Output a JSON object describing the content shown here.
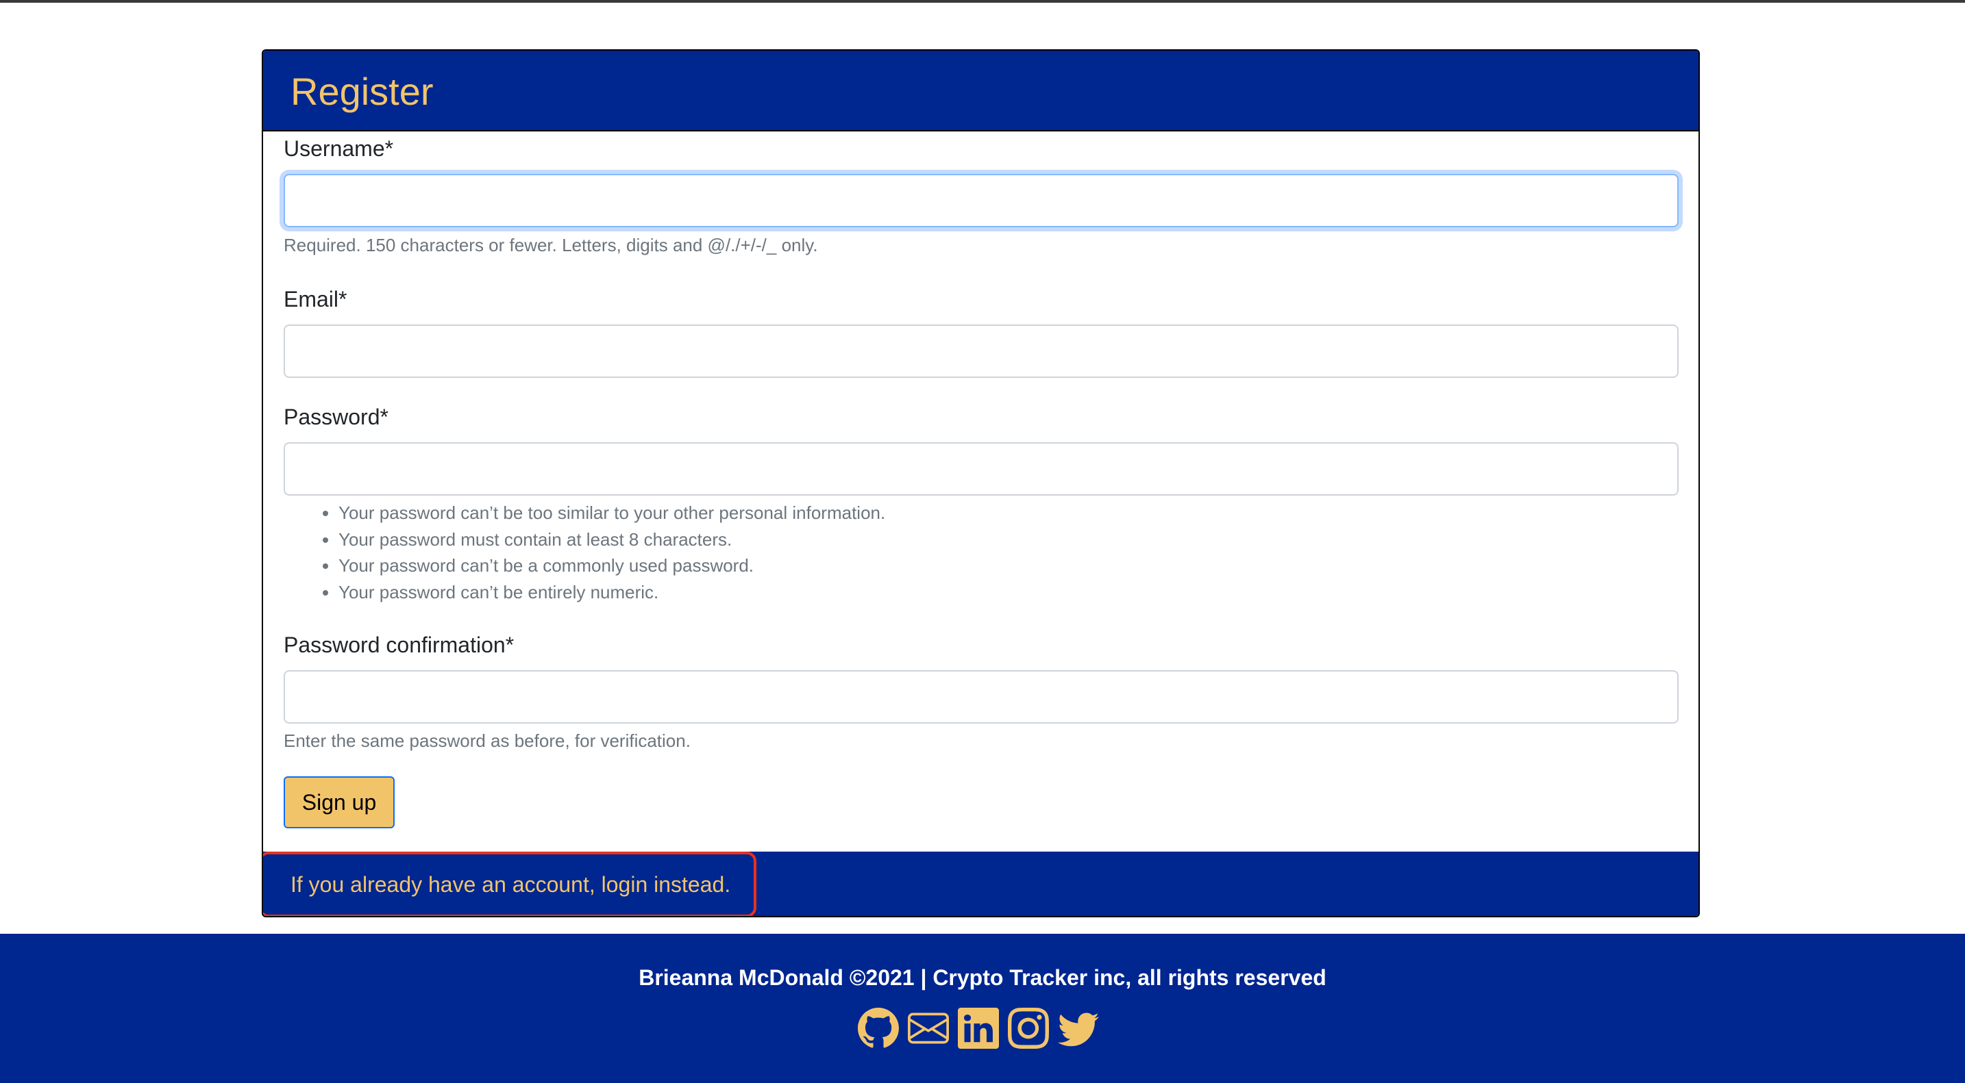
{
  "card": {
    "title": "Register"
  },
  "form": {
    "username": {
      "label": "Username*",
      "value": "",
      "placeholder": "",
      "help": "Required. 150 characters or fewer. Letters, digits and @/./+/-/_ only."
    },
    "email": {
      "label": "Email*",
      "value": "",
      "placeholder": ""
    },
    "password": {
      "label": "Password*",
      "value": "",
      "placeholder": "",
      "help_items": [
        "Your password can’t be too similar to your other personal information.",
        "Your password must contain at least 8 characters.",
        "Your password can’t be a commonly used password.",
        "Your password can’t be entirely numeric."
      ]
    },
    "password_confirmation": {
      "label": "Password confirmation*",
      "value": "",
      "placeholder": "",
      "help": "Enter the same password as before, for verification."
    },
    "submit_label": "Sign up"
  },
  "card_footer": {
    "prefix": "If you already have an account, ",
    "link_label": "login",
    "suffix": " instead."
  },
  "site_footer": {
    "copyright": "Brieanna McDonald ©2021 | Crypto Tracker inc, all rights reserved",
    "social_icons": [
      "github-icon",
      "envelope-icon",
      "linkedin-icon",
      "instagram-icon",
      "twitter-icon"
    ]
  },
  "colors": {
    "brand_navy": "#002690",
    "accent_gold": "#f2c46a",
    "highlight_red": "#e8321e",
    "focus_blue": "#86b7fe"
  }
}
